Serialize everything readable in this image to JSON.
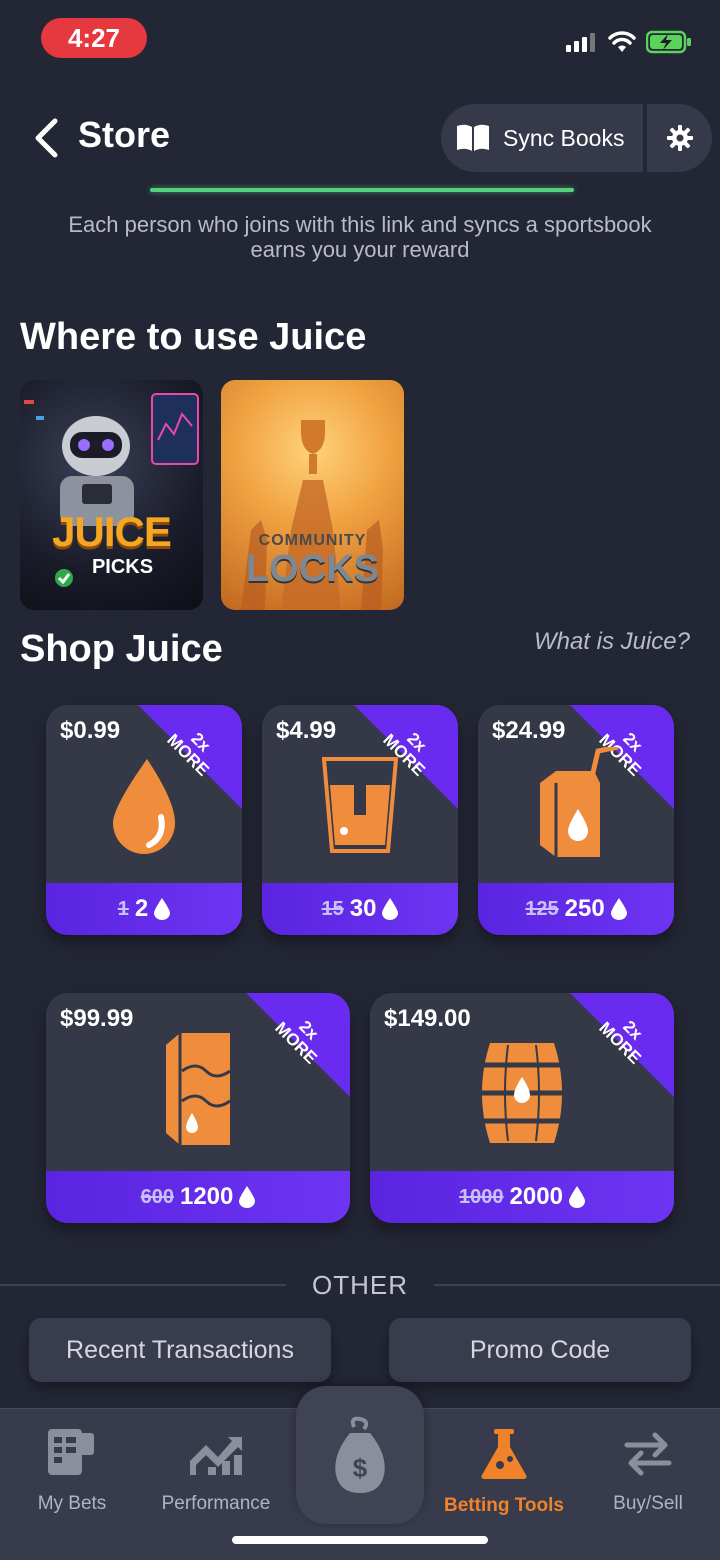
{
  "status_bar": {
    "time": "4:27"
  },
  "header": {
    "title": "Store",
    "sync_label": "Sync Books"
  },
  "referral": {
    "text": "Each person who joins with this link and syncs a sportsbook earns you your reward"
  },
  "where_to_use": {
    "title": "Where to use Juice",
    "cards": [
      {
        "line1": "JUICE",
        "line2": "PICKS"
      },
      {
        "line1": "COMMUNITY",
        "line2": "LOCKS"
      }
    ]
  },
  "shop": {
    "title": "Shop Juice",
    "what_is_link": "What is Juice?",
    "ribbon_top": "2x",
    "ribbon_bottom": "MORE",
    "products": [
      {
        "price": "$0.99",
        "old": "1",
        "new": "2",
        "icon": "drop-icon"
      },
      {
        "price": "$4.99",
        "old": "15",
        "new": "30",
        "icon": "glass-icon"
      },
      {
        "price": "$24.99",
        "old": "125",
        "new": "250",
        "icon": "juice-box-icon"
      },
      {
        "price": "$99.99",
        "old": "600",
        "new": "1200",
        "icon": "juice-carton-icon"
      },
      {
        "price": "$149.00",
        "old": "1000",
        "new": "2000",
        "icon": "barrel-icon"
      }
    ]
  },
  "other": {
    "label": "OTHER",
    "recent_transactions": "Recent Transactions",
    "promo_code": "Promo Code"
  },
  "tabs": {
    "my_bets": "My Bets",
    "performance": "Performance",
    "betting_tools": "Betting Tools",
    "buy_sell": "Buy/Sell"
  },
  "colors": {
    "accent": "#f0832a",
    "purple": "#6a2bf0",
    "background": "#232634",
    "green": "#55d17e"
  }
}
